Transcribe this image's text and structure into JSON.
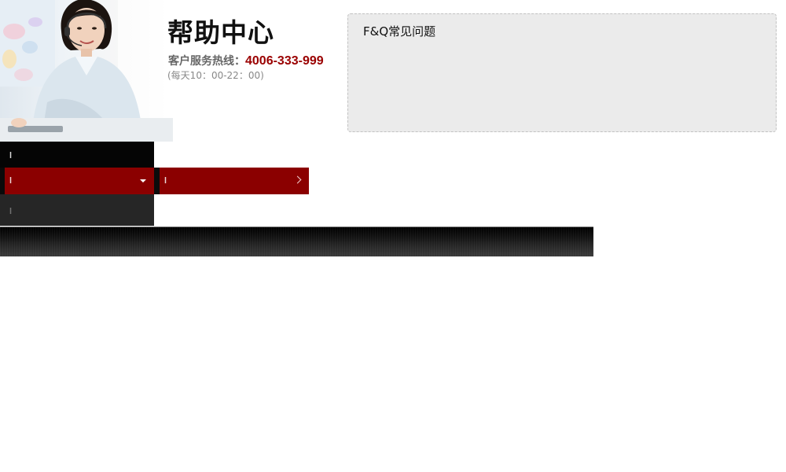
{
  "header": {
    "title": "帮助中心",
    "hotline_label": "客户服务热线：",
    "hotline_number": "4006-333-999",
    "hours": "(每天10：00-22：00)",
    "hotline_color": "#9a0000"
  },
  "faq": {
    "title": "F&Q常见问题"
  },
  "menu": {
    "red_color": "#8b0000",
    "items": [
      {
        "icon": "grip-icon"
      },
      {
        "icon": "caret-down-icon"
      },
      {
        "icon": "chevron-right-icon"
      },
      {
        "icon": "grip-icon"
      }
    ]
  },
  "icons": {
    "photo": "customer-service-agent-photo"
  }
}
